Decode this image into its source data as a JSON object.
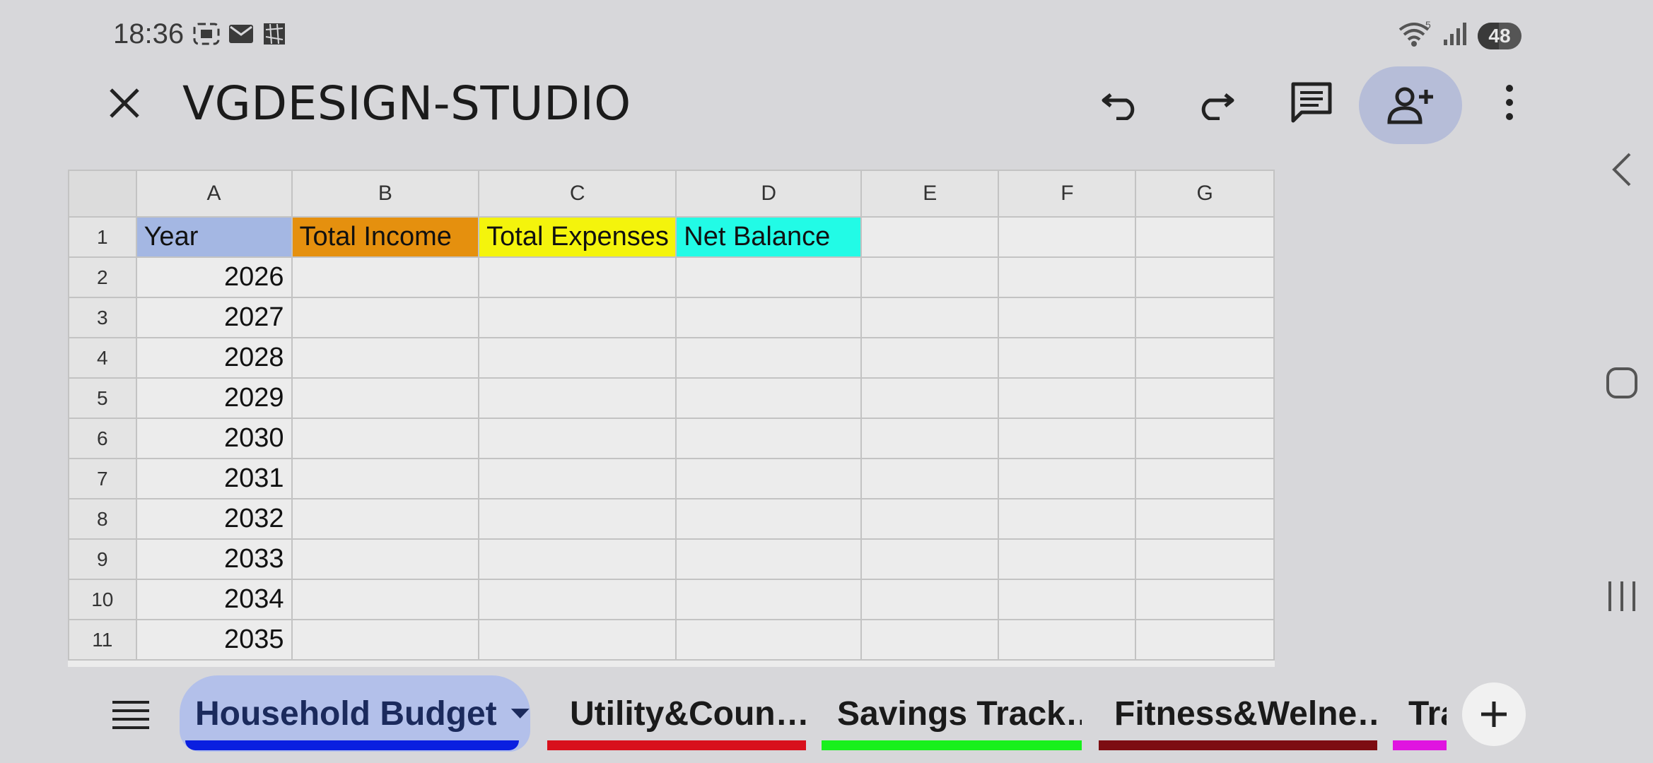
{
  "status_bar": {
    "time": "18:36",
    "battery": "48",
    "icons": [
      "screenshot-icon",
      "mail-icon",
      "app-icon",
      "wifi-icon",
      "signal-icon",
      "battery-icon"
    ],
    "wifi_badge": "5"
  },
  "toolbar": {
    "title": "VGDESIGN-STUDIO",
    "icons": [
      "close-icon",
      "undo-icon",
      "redo-icon",
      "comment-icon",
      "add-person-icon",
      "more-vert-icon"
    ]
  },
  "grid": {
    "columns": [
      "A",
      "B",
      "C",
      "D",
      "E",
      "F",
      "G"
    ],
    "header_row": {
      "number": "1",
      "cells": [
        "Year",
        "Total Income",
        "Total Expenses",
        "Net Balance",
        "",
        "",
        ""
      ]
    },
    "header_colors": {
      "A": "#a4b7e3",
      "B": "#e5900e",
      "C": "#f4f40c",
      "D": "#22fbe6"
    },
    "rows": [
      {
        "number": "2",
        "year": "2026"
      },
      {
        "number": "3",
        "year": "2027"
      },
      {
        "number": "4",
        "year": "2028"
      },
      {
        "number": "5",
        "year": "2029"
      },
      {
        "number": "6",
        "year": "2030"
      },
      {
        "number": "7",
        "year": "2031"
      },
      {
        "number": "8",
        "year": "2032"
      },
      {
        "number": "9",
        "year": "2033"
      },
      {
        "number": "10",
        "year": "2034"
      },
      {
        "number": "11",
        "year": "2035"
      }
    ]
  },
  "sheets": {
    "tabs": [
      {
        "label": "Household Budget",
        "color": "#0a1fe0",
        "active": true
      },
      {
        "label": "Utility&Coun…",
        "color": "#d8101c"
      },
      {
        "label": "Savings Track…",
        "color": "#18f01c"
      },
      {
        "label": "Fitness&Welne…",
        "color": "#7d0d12"
      },
      {
        "label": "Tra",
        "color": "#e014e0"
      }
    ],
    "icons": [
      "menu-icon",
      "dropdown-icon",
      "plus-icon"
    ]
  },
  "nav": {
    "icons": [
      "back-icon",
      "home-icon",
      "recents-icon"
    ]
  }
}
